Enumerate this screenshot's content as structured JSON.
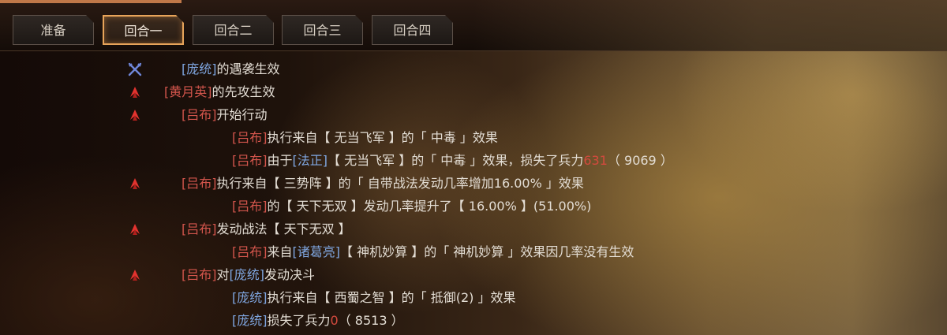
{
  "tabs": [
    "准备",
    "回合一",
    "回合二",
    "回合三",
    "回合四"
  ],
  "active_tab": "回合一",
  "log": [
    {
      "icon": "crossed-swords-icon",
      "parts": [
        {
          "t": "[庞统]",
          "c": "blue"
        },
        {
          "t": "的遇袭生效"
        }
      ]
    },
    {
      "icon": "red-flag-icon",
      "parts": [
        {
          "t": "[黄月英]",
          "c": "red"
        },
        {
          "t": "的先攻生效"
        }
      ]
    },
    {
      "icon": "red-flag-icon",
      "parts": [
        {
          "t": "[吕布]",
          "c": "red"
        },
        {
          "t": "开始行动"
        }
      ]
    },
    {
      "icon": "",
      "parts": [
        {
          "t": "[吕布]",
          "c": "red"
        },
        {
          "t": "执行来自【 无当飞军 】的「 中毒 」效果"
        }
      ]
    },
    {
      "icon": "",
      "parts": [
        {
          "t": "[吕布]",
          "c": "red"
        },
        {
          "t": "由于"
        },
        {
          "t": "[法正]",
          "c": "blue"
        },
        {
          "t": "【 无当飞军 】的「 中毒 」效果，损失了兵力"
        },
        {
          "t": "631",
          "c": "num"
        },
        {
          "t": "（ 9069 ）"
        }
      ]
    },
    {
      "icon": "red-flag-icon",
      "parts": [
        {
          "t": "[吕布]",
          "c": "red"
        },
        {
          "t": "执行来自【 三势阵 】的「 自带战法发动几率增加16.00% 」效果"
        }
      ]
    },
    {
      "icon": "",
      "parts": [
        {
          "t": "[吕布]",
          "c": "red"
        },
        {
          "t": "的【 天下无双 】发动几率提升了【 16.00% 】(51.00%)"
        }
      ]
    },
    {
      "icon": "red-flag-icon",
      "parts": [
        {
          "t": "[吕布]",
          "c": "red"
        },
        {
          "t": "发动战法【 天下无双 】"
        }
      ]
    },
    {
      "icon": "",
      "parts": [
        {
          "t": "[吕布]",
          "c": "red"
        },
        {
          "t": "来自"
        },
        {
          "t": "[诸葛亮]",
          "c": "blue"
        },
        {
          "t": "【 神机妙算 】的「 神机妙算 」效果因几率没有生效"
        }
      ]
    },
    {
      "icon": "red-flag-icon",
      "parts": [
        {
          "t": "[吕布]",
          "c": "red"
        },
        {
          "t": "对"
        },
        {
          "t": "[庞统]",
          "c": "blue"
        },
        {
          "t": "发动决斗"
        }
      ]
    },
    {
      "icon": "",
      "parts": [
        {
          "t": "[庞统]",
          "c": "blue"
        },
        {
          "t": "执行来自【 西蜀之智 】的「 抵御(2) 」效果"
        }
      ]
    },
    {
      "icon": "",
      "parts": [
        {
          "t": "[庞统]",
          "c": "blue"
        },
        {
          "t": "损失了兵力"
        },
        {
          "t": "0",
          "c": "num"
        },
        {
          "t": "（ 8513 ）"
        }
      ]
    }
  ]
}
